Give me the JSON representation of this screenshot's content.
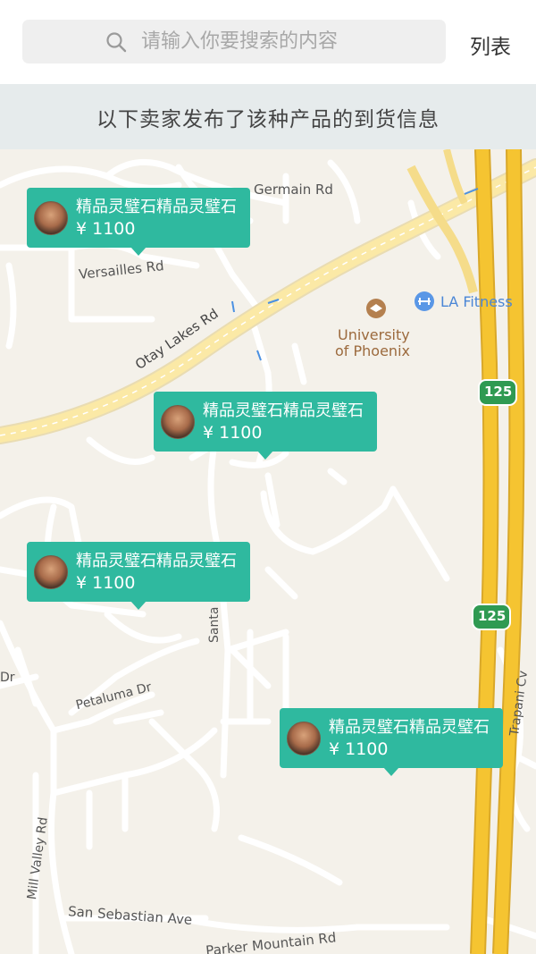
{
  "search": {
    "placeholder": "请输入你要搜索的内容"
  },
  "header": {
    "list_label": "列表"
  },
  "banner": {
    "text": "以下卖家发布了该种产品的到货信息"
  },
  "map": {
    "labels": {
      "germain": "Germain Rd",
      "versailles": "Versailles Rd",
      "otay": "Otay Lakes Rd",
      "university": "University",
      "phoenix": "of Phoenix",
      "la_fitness": "LA Fitness",
      "route1": "125",
      "route2": "125",
      "santa": "Santa",
      "petaluma": "Petaluma Dr",
      "trapani": "Trapani Cv",
      "mill_valley": "Mill Valley Rd",
      "san_sebastian": "San Sebastian Ave",
      "parker": "Parker Mountain Rd",
      "dr": "Dr"
    }
  },
  "pins": [
    {
      "title": "精品灵璧石精品灵璧石",
      "price": "¥ 1100"
    },
    {
      "title": "精品灵璧石精品灵璧石",
      "price": "¥ 1100"
    },
    {
      "title": "精品灵璧石精品灵璧石",
      "price": "¥ 1100"
    },
    {
      "title": "精品灵璧石精品灵璧石",
      "price": "¥ 1100"
    }
  ],
  "colors": {
    "accent": "#2fb99f",
    "highway": "#f5c431",
    "map_bg": "#f4f1ea"
  }
}
